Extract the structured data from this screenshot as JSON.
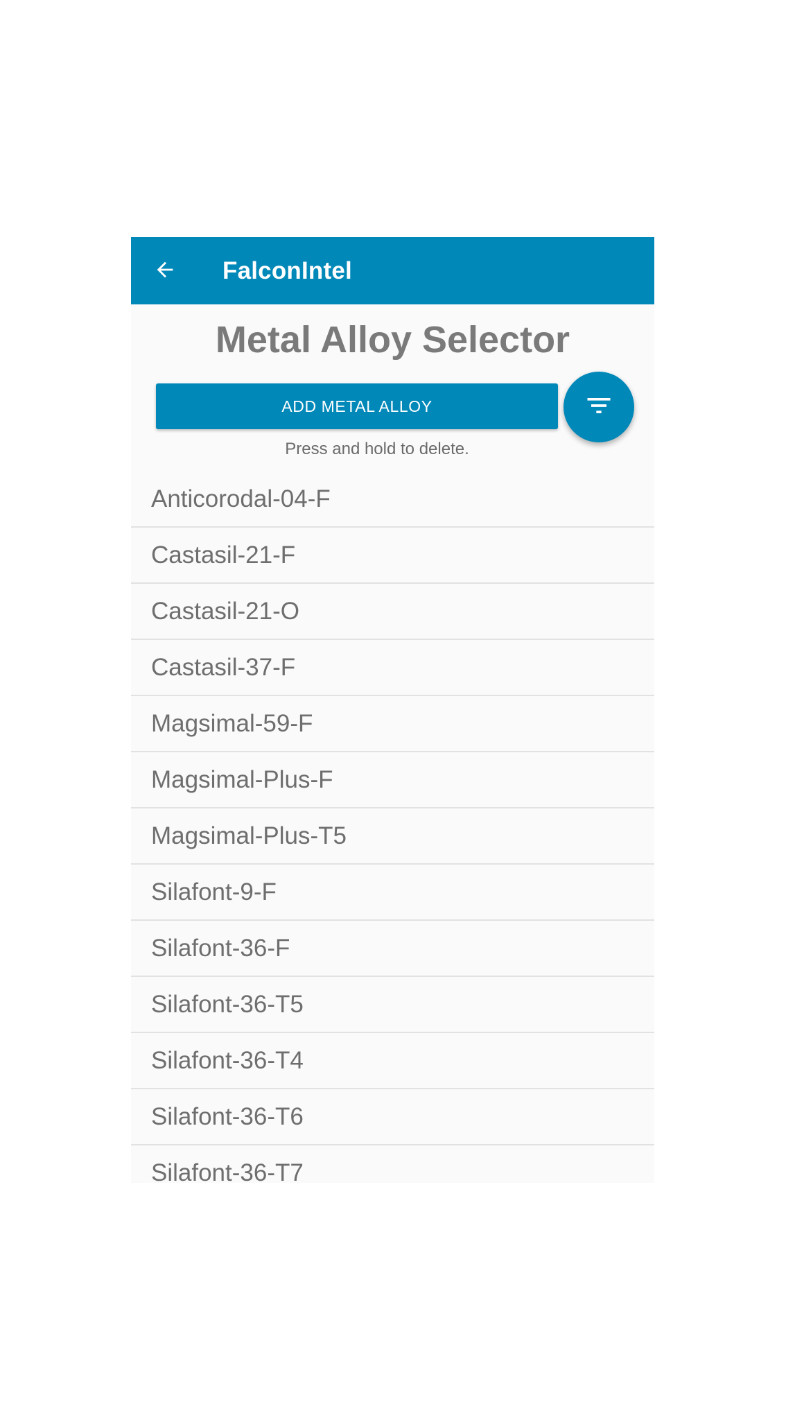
{
  "app_bar": {
    "title": "FalconIntel",
    "back_icon": "arrow-left-icon",
    "background": "#0088b9"
  },
  "page": {
    "title": "Metal Alloy Selector",
    "add_button_label": "ADD METAL ALLOY",
    "filter_icon": "filter-icon",
    "hint": "Press and hold to delete."
  },
  "alloys": [
    "Anticorodal-04-F",
    "Castasil-21-F",
    "Castasil-21-O",
    "Castasil-37-F",
    "Magsimal-59-F",
    "Magsimal-Plus-F",
    "Magsimal-Plus-T5",
    "Silafont-9-F",
    "Silafont-36-F",
    "Silafont-36-T5",
    "Silafont-36-T4",
    "Silafont-36-T6",
    "Silafont-36-T7"
  ],
  "colors": {
    "accent": "#0088b9",
    "text_muted": "#7a7a7a",
    "divider": "#e2e2e2"
  }
}
